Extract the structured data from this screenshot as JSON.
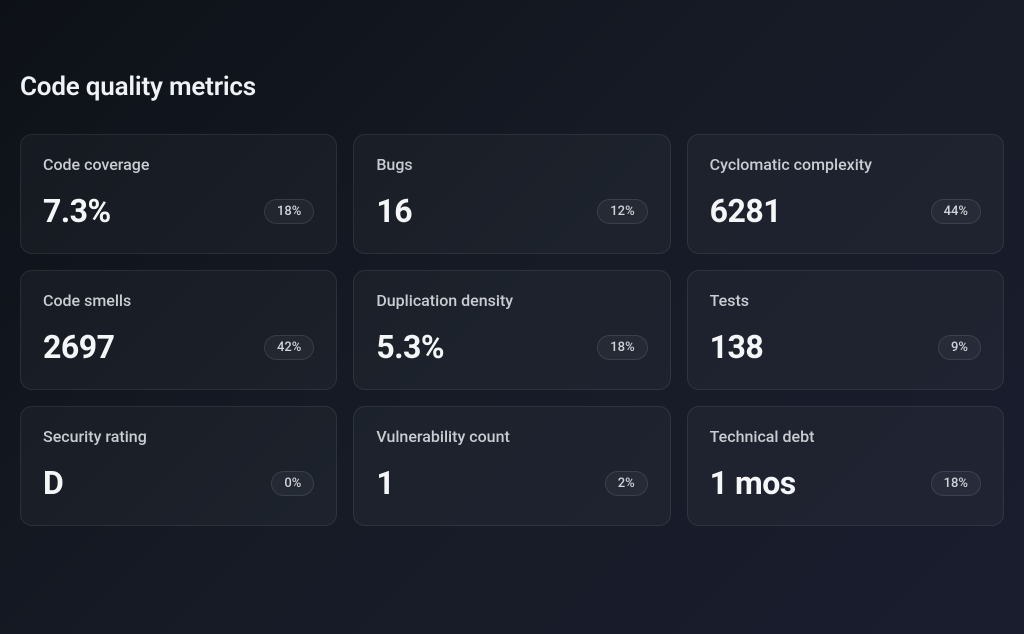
{
  "title": "Code quality metrics",
  "cards": [
    {
      "label": "Code coverage",
      "value": "7.3%",
      "badge": "18%"
    },
    {
      "label": "Bugs",
      "value": "16",
      "badge": "12%"
    },
    {
      "label": "Cyclomatic complexity",
      "value": "6281",
      "badge": "44%"
    },
    {
      "label": "Code smells",
      "value": "2697",
      "badge": "42%"
    },
    {
      "label": "Duplication density",
      "value": "5.3%",
      "badge": "18%"
    },
    {
      "label": "Tests",
      "value": "138",
      "badge": "9%"
    },
    {
      "label": "Security rating",
      "value": "D",
      "badge": "0%"
    },
    {
      "label": "Vulnerability count",
      "value": "1",
      "badge": "2%"
    },
    {
      "label": "Technical debt",
      "value": "1 mos",
      "badge": "18%"
    }
  ]
}
